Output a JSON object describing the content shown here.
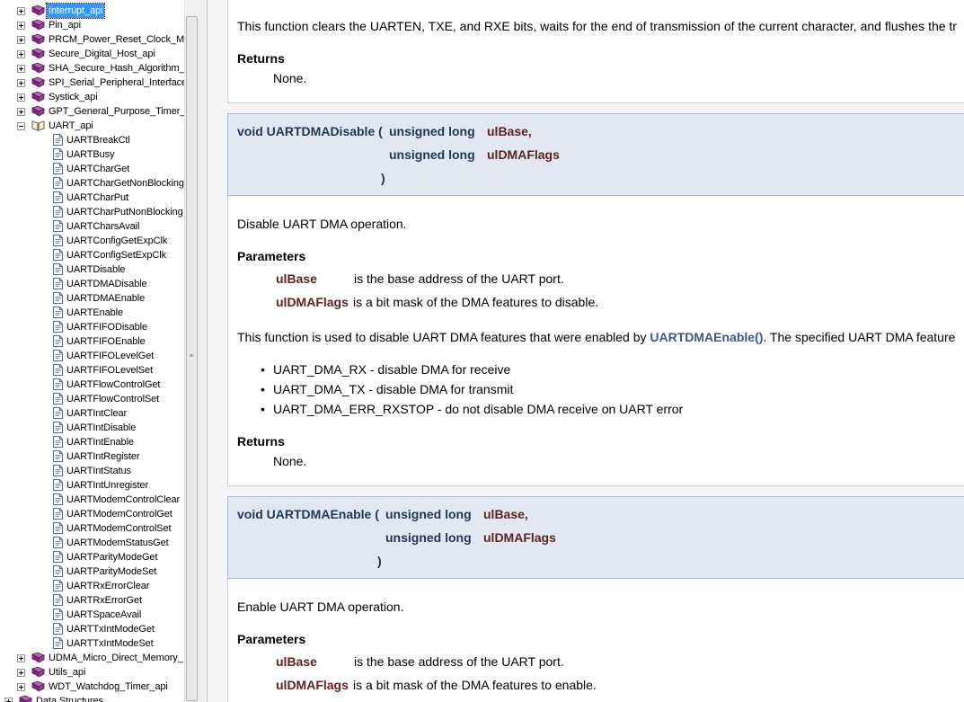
{
  "tree": {
    "nodes": [
      {
        "label": "Interrupt_api",
        "type": "book",
        "expander": "plus",
        "selected": true
      },
      {
        "label": "Pin_api",
        "type": "book",
        "expander": "plus"
      },
      {
        "label": "PRCM_Power_Reset_Clock_M",
        "type": "book",
        "expander": "plus"
      },
      {
        "label": "Secure_Digital_Host_api",
        "type": "book",
        "expander": "plus"
      },
      {
        "label": "SHA_Secure_Hash_Algorithm_",
        "type": "book",
        "expander": "plus"
      },
      {
        "label": "SPI_Serial_Peripheral_Interface",
        "type": "book",
        "expander": "plus"
      },
      {
        "label": "Systick_api",
        "type": "book",
        "expander": "plus"
      },
      {
        "label": "GPT_General_Purpose_Timer_",
        "type": "book",
        "expander": "plus"
      },
      {
        "label": "UART_api",
        "type": "openbook",
        "expander": "minus"
      },
      {
        "label": "UARTBreakCtl",
        "type": "page"
      },
      {
        "label": "UARTBusy",
        "type": "page"
      },
      {
        "label": "UARTCharGet",
        "type": "page"
      },
      {
        "label": "UARTCharGetNonBlocking",
        "type": "page"
      },
      {
        "label": "UARTCharPut",
        "type": "page"
      },
      {
        "label": "UARTCharPutNonBlocking",
        "type": "page"
      },
      {
        "label": "UARTCharsAvail",
        "type": "page"
      },
      {
        "label": "UARTConfigGetExpClk",
        "type": "page"
      },
      {
        "label": "UARTConfigSetExpClk",
        "type": "page"
      },
      {
        "label": "UARTDisable",
        "type": "page"
      },
      {
        "label": "UARTDMADisable",
        "type": "page"
      },
      {
        "label": "UARTDMAEnable",
        "type": "page"
      },
      {
        "label": "UARTEnable",
        "type": "page"
      },
      {
        "label": "UARTFIFODisable",
        "type": "page"
      },
      {
        "label": "UARTFIFOEnable",
        "type": "page"
      },
      {
        "label": "UARTFIFOLevelGet",
        "type": "page"
      },
      {
        "label": "UARTFIFOLevelSet",
        "type": "page"
      },
      {
        "label": "UARTFlowControlGet",
        "type": "page"
      },
      {
        "label": "UARTFlowControlSet",
        "type": "page"
      },
      {
        "label": "UARTIntClear",
        "type": "page"
      },
      {
        "label": "UARTIntDisable",
        "type": "page"
      },
      {
        "label": "UARTIntEnable",
        "type": "page"
      },
      {
        "label": "UARTIntRegister",
        "type": "page"
      },
      {
        "label": "UARTIntStatus",
        "type": "page"
      },
      {
        "label": "UARTIntUnregister",
        "type": "page"
      },
      {
        "label": "UARTModemControlClear",
        "type": "page"
      },
      {
        "label": "UARTModemControlGet",
        "type": "page"
      },
      {
        "label": "UARTModemControlSet",
        "type": "page"
      },
      {
        "label": "UARTModemStatusGet",
        "type": "page"
      },
      {
        "label": "UARTParityModeGet",
        "type": "page"
      },
      {
        "label": "UARTParityModeSet",
        "type": "page"
      },
      {
        "label": "UARTRxErrorClear",
        "type": "page"
      },
      {
        "label": "UARTRxErrorGet",
        "type": "page"
      },
      {
        "label": "UARTSpaceAvail",
        "type": "page"
      },
      {
        "label": "UARTTxIntModeGet",
        "type": "page"
      },
      {
        "label": "UARTTxIntModeSet",
        "type": "page"
      },
      {
        "label": "UDMA_Micro_Direct_Memory_",
        "type": "book",
        "expander": "plus"
      },
      {
        "label": "Utils_api",
        "type": "book",
        "expander": "plus"
      },
      {
        "label": "WDT_Watchdog_Timer_api",
        "type": "book",
        "expander": "plus"
      },
      {
        "label": "Data Structures",
        "type": "book",
        "expander": "plus",
        "root": true
      }
    ]
  },
  "doc": {
    "top": {
      "text": "This function clears the UARTEN, TXE, and RXE bits, waits for the end of transmission of the current character, and flushes the tr",
      "returns_heading": "Returns",
      "returns_value": "None."
    },
    "dma_disable": {
      "return_type": "void",
      "func": "UARTDMADisable",
      "open_paren": "(",
      "close_paren": ")",
      "param1_type": "unsigned long",
      "param1_name": "ulBase,",
      "param2_type": "unsigned long",
      "param2_name": "ulDMAFlags",
      "brief": "Disable UART DMA operation.",
      "params_heading": "Parameters",
      "p1_name": "ulBase",
      "p1_desc": "is the base address of the UART port.",
      "p2_name": "ulDMAFlags",
      "p2_desc": "is a bit mask of the DMA features to disable.",
      "detail_pre": "This function is used to disable UART DMA features that were enabled by ",
      "detail_link": "UARTDMAEnable()",
      "detail_post": ". The specified UART DMA feature",
      "bullets": [
        "UART_DMA_RX - disable DMA for receive",
        "UART_DMA_TX - disable DMA for transmit",
        "UART_DMA_ERR_RXSTOP - do not disable DMA receive on UART error"
      ],
      "returns_heading": "Returns",
      "returns_value": "None."
    },
    "dma_enable": {
      "return_type": "void",
      "func": "UARTDMAEnable",
      "open_paren": "(",
      "close_paren": ")",
      "param1_type": "unsigned long",
      "param1_name": "ulBase,",
      "param2_type": "unsigned long",
      "param2_name": "ulDMAFlags",
      "brief": "Enable UART DMA operation.",
      "params_heading": "Parameters",
      "p1_name": "ulBase",
      "p1_desc": "is the base address of the UART port.",
      "p2_name": "ulDMAFlags",
      "p2_desc": "is a bit mask of the DMA features to enable."
    }
  },
  "colors": {
    "proto_bg": "#e2e8f2",
    "param_name": "#602020",
    "link": "#3d578c",
    "selection": "#3399ff"
  }
}
